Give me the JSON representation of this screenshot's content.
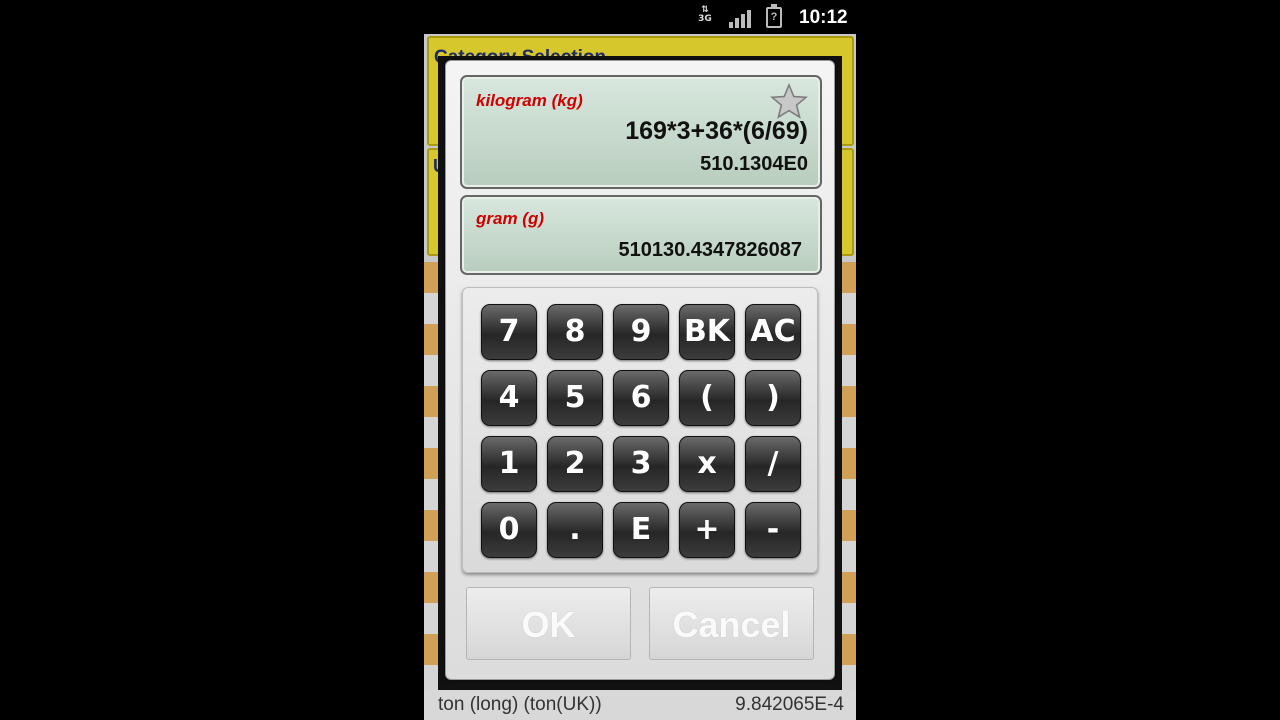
{
  "status_bar": {
    "network_type": "3G",
    "time": "10:12",
    "icons": [
      "network-3g-icon",
      "signal-icon",
      "battery-icon"
    ]
  },
  "background_app": {
    "header_title": "Category Selection",
    "second_box_text": "U",
    "bottom_row": {
      "unit": "ton (long) (ton(UK))",
      "value": "9.842065E-4"
    }
  },
  "dialog": {
    "from": {
      "unit": "kilogram (kg)",
      "expression": "169*3+36*(6/69)",
      "result": "510.1304E0",
      "favorite_icon": "star-icon"
    },
    "to": {
      "unit": "gram (g)",
      "result": "510130.4347826087"
    },
    "keys": [
      [
        "7",
        "8",
        "9",
        "BK",
        "AC"
      ],
      [
        "4",
        "5",
        "6",
        "(",
        ")"
      ],
      [
        "1",
        "2",
        "3",
        "x",
        "/"
      ],
      [
        "0",
        ".",
        "E",
        "+",
        "-"
      ]
    ],
    "ok_label": "OK",
    "cancel_label": "Cancel"
  },
  "colors": {
    "unit_label": "#d00000",
    "display_bg": "#c8dacb",
    "key_bg": "#333333",
    "header_bg": "#d6c82c"
  }
}
